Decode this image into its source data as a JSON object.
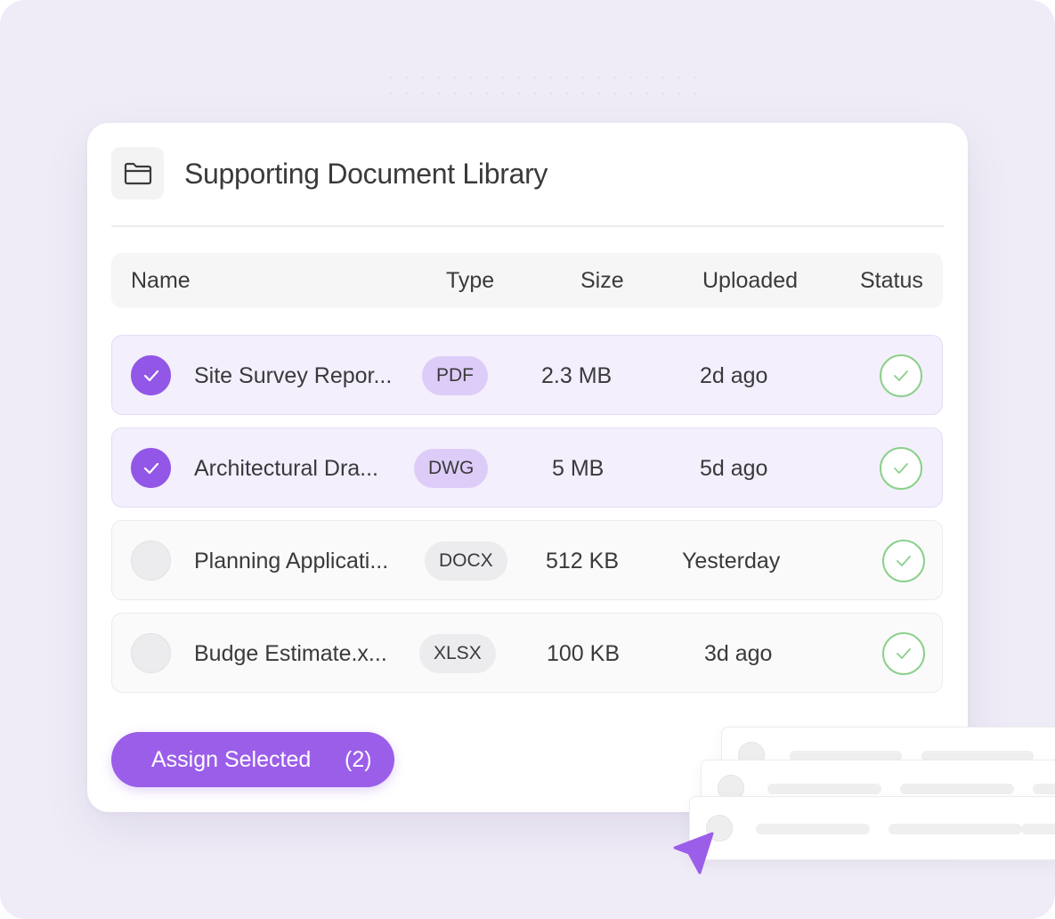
{
  "card": {
    "title": "Supporting Document Library"
  },
  "table": {
    "columns": {
      "name": "Name",
      "type": "Type",
      "size": "Size",
      "uploaded": "Uploaded",
      "status": "Status"
    },
    "rows": [
      {
        "name": "Site Survey Repor...",
        "type": "PDF",
        "size": "2.3 MB",
        "uploaded": "2d ago",
        "selected": true,
        "status": "complete"
      },
      {
        "name": "Architectural Dra...",
        "type": "DWG",
        "size": "5 MB",
        "uploaded": "5d ago",
        "selected": true,
        "status": "complete"
      },
      {
        "name": "Planning Applicati...",
        "type": "DOCX",
        "size": "512 KB",
        "uploaded": "Yesterday",
        "selected": false,
        "status": "complete"
      },
      {
        "name": "Budge Estimate.x...",
        "type": "XLSX",
        "size": "100 KB",
        "uploaded": "3d ago",
        "selected": false,
        "status": "complete"
      }
    ]
  },
  "actions": {
    "assign_label": "Assign Selected",
    "assign_count": "(2)"
  },
  "colors": {
    "accent": "#9b5ee9",
    "checkbox_selected": "#9257e6",
    "selected_row_bg": "#f3effc",
    "selected_pill_bg": "#ddccf8",
    "status_ok": "#8bd08a",
    "backdrop": "#efecf7"
  },
  "icons": {
    "header": "folder-icon",
    "checkbox": "check-icon",
    "status": "check-circle-icon",
    "pointer": "cursor-arrow-icon"
  }
}
